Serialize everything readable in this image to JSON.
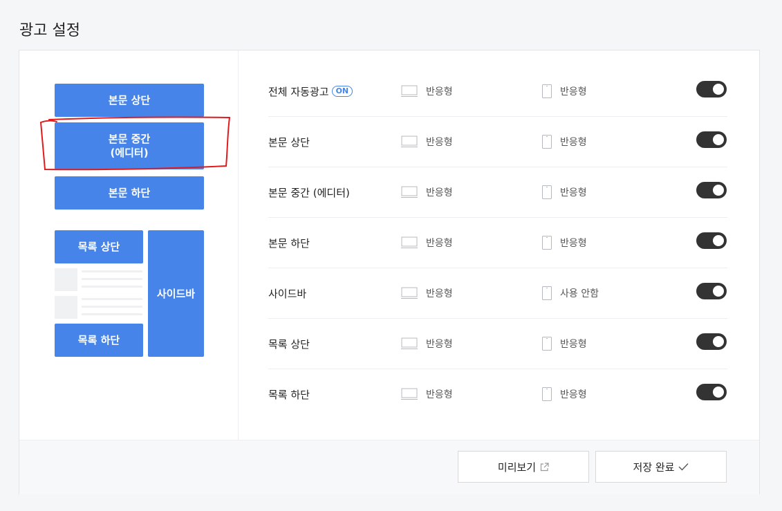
{
  "page": {
    "title": "광고 설정"
  },
  "layout_preview": {
    "body_top": "본문 상단",
    "body_middle_line1": "본문 중간",
    "body_middle_line2": "(에디터)",
    "body_bottom": "본문 하단",
    "list_top": "목록 상단",
    "list_bottom": "목록 하단",
    "sidebar": "사이드바"
  },
  "settings": {
    "on_badge": "ON",
    "rows": [
      {
        "name": "전체 자동광고",
        "pc": "반응형",
        "mobile": "반응형",
        "enabled": true
      },
      {
        "name": "본문 상단",
        "pc": "반응형",
        "mobile": "반응형",
        "enabled": true
      },
      {
        "name": "본문 중간 (에디터)",
        "pc": "반응형",
        "mobile": "반응형",
        "enabled": true
      },
      {
        "name": "본문 하단",
        "pc": "반응형",
        "mobile": "반응형",
        "enabled": true
      },
      {
        "name": "사이드바",
        "pc": "반응형",
        "mobile": "사용 안함",
        "enabled": true
      },
      {
        "name": "목록 상단",
        "pc": "반응형",
        "mobile": "반응형",
        "enabled": true
      },
      {
        "name": "목록 하단",
        "pc": "반응형",
        "mobile": "반응형",
        "enabled": true
      }
    ]
  },
  "footer": {
    "preview_label": "미리보기",
    "save_label": "저장 완료"
  },
  "colors": {
    "accent": "#4684e9",
    "toggle_on": "#333333",
    "highlight": "#e01b1b"
  }
}
